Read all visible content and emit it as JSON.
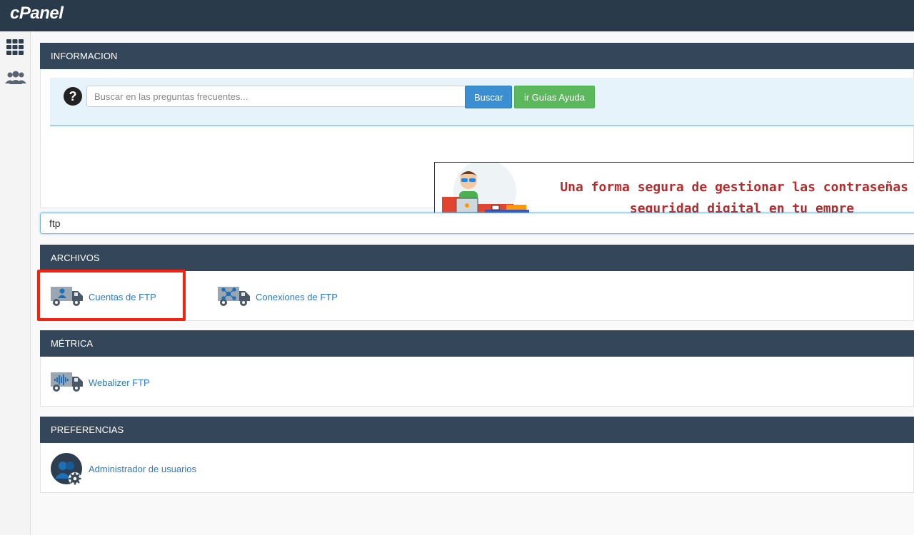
{
  "app": {
    "logo": "cPanel"
  },
  "sidenav": [
    {
      "name": "apps-grid-icon"
    },
    {
      "name": "users-group-icon"
    }
  ],
  "info": {
    "header": "INFORMACION",
    "search_placeholder": "Buscar en las preguntas frecuentes...",
    "search_button": "Buscar",
    "guides_button": "ir Guías Ayuda",
    "banner_line1": "Una forma segura de gestionar las contraseñas y",
    "banner_line2": "seguridad digital en tu empre"
  },
  "filter": {
    "value": "ftp"
  },
  "sections": {
    "archivos": {
      "header": "ARCHIVOS",
      "items": [
        {
          "label": "Cuentas de FTP",
          "icon": "ftp-accounts-truck-icon"
        },
        {
          "label": "Conexiones de FTP",
          "icon": "ftp-connections-truck-icon"
        }
      ]
    },
    "metrica": {
      "header": "MÉTRICA",
      "items": [
        {
          "label": "Webalizer FTP",
          "icon": "webalizer-ftp-truck-icon"
        }
      ]
    },
    "preferencias": {
      "header": "PREFERENCIAS",
      "items": [
        {
          "label": "Administrador de usuarios",
          "icon": "user-manager-icon"
        }
      ]
    }
  },
  "colors": {
    "topbar": "#293a4a",
    "panel_header": "#34465a",
    "link": "#2b7bc0",
    "highlight": "#f2230f",
    "primary_button": "#3a8fd3",
    "success_button": "#5cb85c"
  }
}
